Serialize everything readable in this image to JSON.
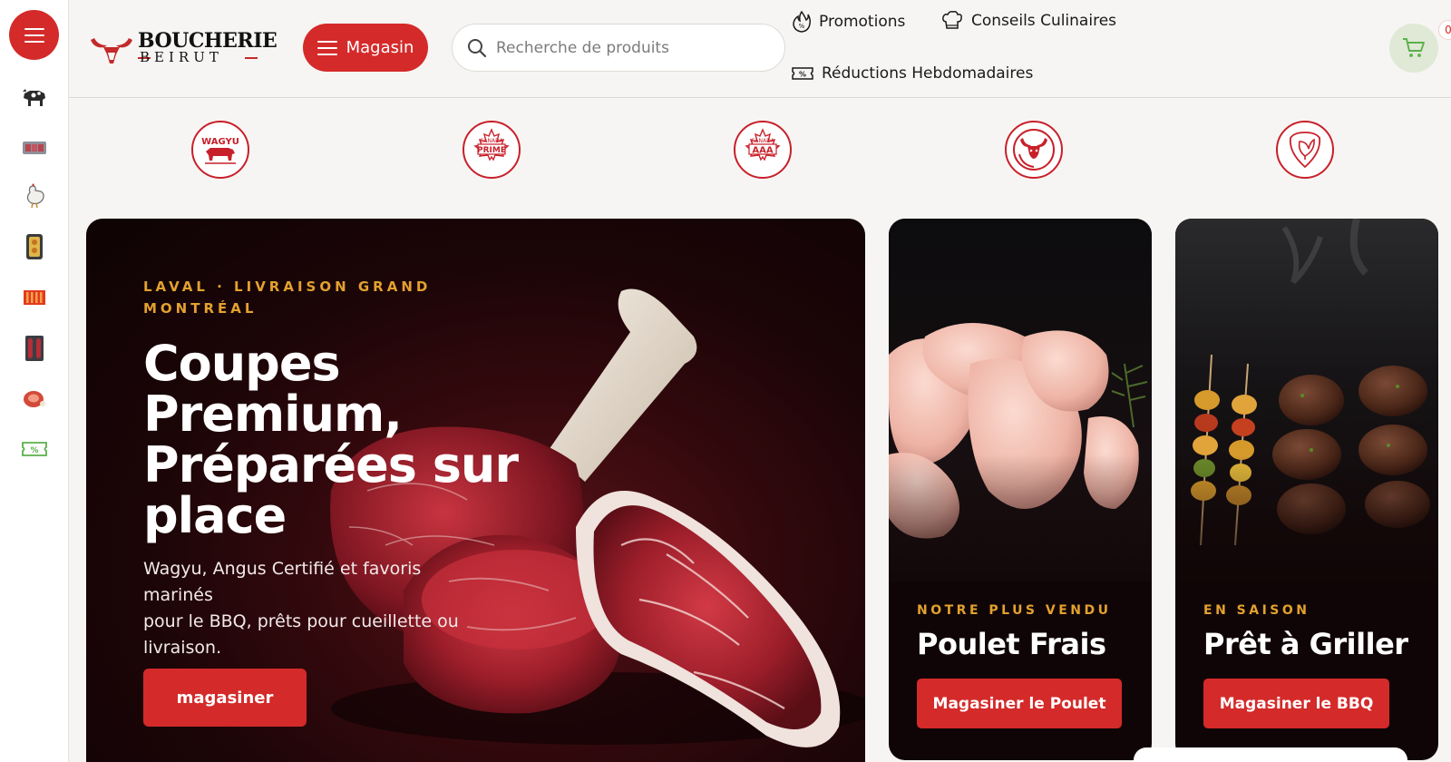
{
  "brand": {
    "name": "BOUCHERIE",
    "sub": "BEIRUT",
    "accent": "#d42a2a"
  },
  "sidebar": {
    "menu_icon": "hamburger-menu-icon",
    "items": [
      {
        "name": "beef",
        "icon": "cow-icon"
      },
      {
        "name": "steaks",
        "icon": "steak-tray-icon"
      },
      {
        "name": "poultry",
        "icon": "chicken-icon"
      },
      {
        "name": "marinated",
        "icon": "marinated-box-icon"
      },
      {
        "name": "bbq",
        "icon": "bbq-grill-icon"
      },
      {
        "name": "sausages",
        "icon": "sausage-icon"
      },
      {
        "name": "deli",
        "icon": "ham-icon"
      },
      {
        "name": "deals",
        "icon": "percent-ticket-icon"
      }
    ]
  },
  "header": {
    "store_label": "Magasin",
    "search_placeholder": "Recherche de produits",
    "nav": {
      "promotions": "Promotions",
      "tips": "Conseils Culinaires",
      "weekly": "Réductions Hebdomadaires"
    },
    "cart_count": "0"
  },
  "badges": [
    {
      "label": "WAGYU",
      "icon": "wagyu-bull-icon"
    },
    {
      "top": "CANADA",
      "label": "PRIME",
      "icon": "maple-leaf-prime-icon"
    },
    {
      "top": "CANADA",
      "label": "AAA",
      "icon": "maple-leaf-aaa-icon"
    },
    {
      "label": "",
      "icon": "bull-head-icon"
    },
    {
      "label": "",
      "icon": "leaf-shield-icon"
    }
  ],
  "hero": {
    "eyebrow_line1": "LAVAL · LIVRAISON GRAND",
    "eyebrow_line2": "MONTRÉAL",
    "title_line1": "Coupes",
    "title_line2": "Premium,",
    "title_line3": "Préparées sur",
    "title_line4": "place",
    "desc_line1": "Wagyu, Angus Certifié et favoris marinés",
    "desc_line2": "pour le BBQ, prêts pour cueillette ou",
    "desc_line3": "livraison.",
    "cta": "magasiner"
  },
  "cards": [
    {
      "eyebrow": "NOTRE PLUS VENDU",
      "title": "Poulet Frais",
      "cta": "Magasiner le Poulet"
    },
    {
      "eyebrow": "EN SAISON",
      "title": "Prêt à Griller",
      "cta": "Magasiner le BBQ"
    }
  ]
}
